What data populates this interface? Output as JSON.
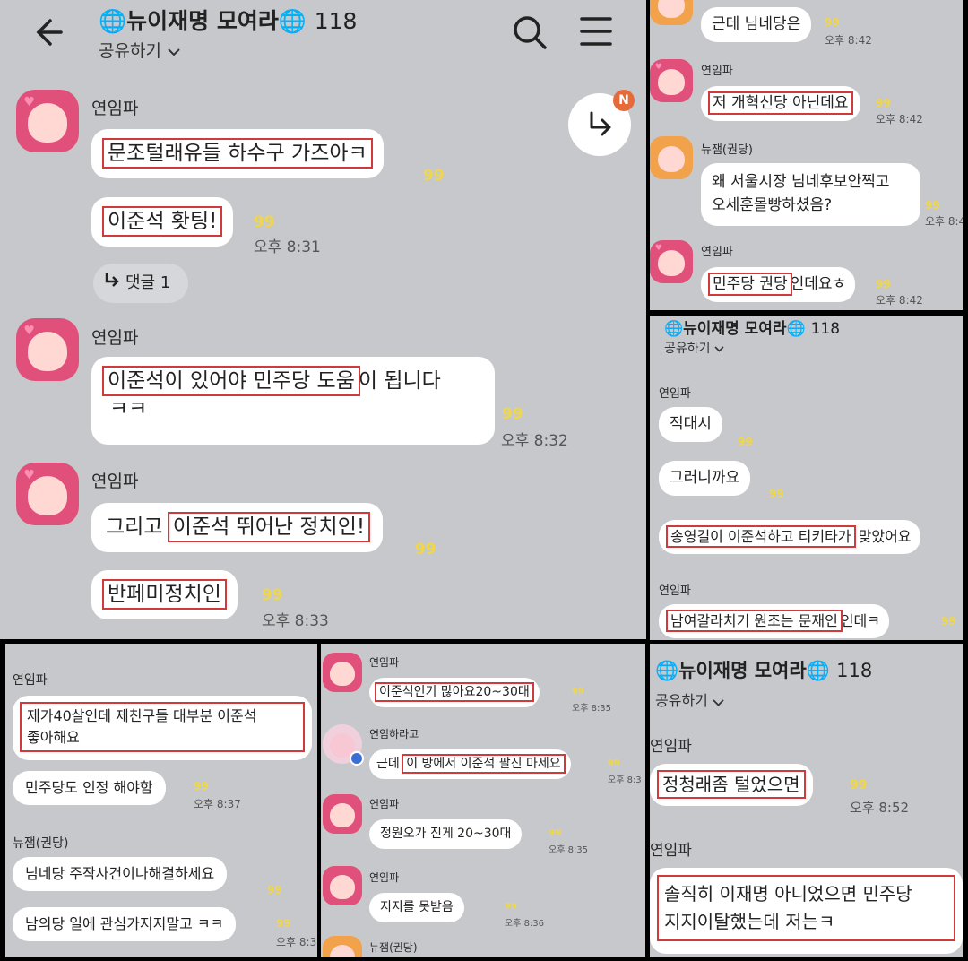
{
  "header": {
    "title": "🌐뉴이재명 모여라🌐",
    "count": "118",
    "share_label": "공유하기",
    "chevron": "chevron-down-icon",
    "back_icon": "back-arrow-icon",
    "search_icon": "search-icon",
    "menu_icon": "hamburger-menu-icon",
    "reply_badge": "N"
  },
  "colors": {
    "background": "#c6c8cc",
    "bubble": "#ffffff",
    "highlight": "#d03a3a",
    "unread": "#f0d64a"
  },
  "unread_mark": "99",
  "main": {
    "sender": "연임파",
    "messages": [
      {
        "text": "문조털래유들 하수구 가즈아ㅋ"
      },
      {
        "text": "이준석 홧팅!",
        "time": "오후 8:31"
      },
      {
        "text_a": "이준석이 있어야 민주당 도움",
        "text_b": "이 됩니다",
        "text_c": "ㅋㅋ",
        "time": "오후 8:32"
      },
      {
        "text_a": "그리고 ",
        "text_b": "이준석 뛰어난 정치인!"
      },
      {
        "text": "반페미정치인",
        "time": "오후 8:33"
      }
    ],
    "reply_label": "댓글 1"
  },
  "top_right": {
    "messages": [
      {
        "text": "근데 님네당은",
        "time": "오후 8:42"
      },
      {
        "sender": "연임파",
        "text": "저 개혁신당 아닌데요",
        "time": "오후 8:42"
      },
      {
        "sender": "뉴잼(권당)",
        "text_a": "왜 서울시장 님네후보안찍고",
        "text_b": "오세훈몰빵하셨음?",
        "time": "오후 8:4"
      },
      {
        "sender": "연임파",
        "text_a": "민주당 권당",
        "text_b": "인데요ㅎ",
        "time": "오후 8:42"
      }
    ]
  },
  "mid_right": {
    "title": "🌐뉴이재명 모여라🌐",
    "count": "118",
    "share_label": "공유하기",
    "sender": "연임파",
    "messages": [
      {
        "text": "적대시"
      },
      {
        "text": "그러니까요"
      },
      {
        "text_a": "송영길이 이준석하고 티키타가",
        "text_b": " 맞았어요"
      }
    ],
    "sender2": "연임파",
    "message2_a": "남여갈라치기 원조는 문재인",
    "message2_b": "인데ㅋ"
  },
  "bottom_left": {
    "sender": "연임파",
    "msg1_a": "제가40살인데 제친구들 대부분 이준석",
    "msg1_b": "좋아해요",
    "msg2": "민주당도 인정 해야함",
    "time2": "오후 8:37",
    "sender2": "뉴잼(권당)",
    "msg3": "님네당 주작사건이나해결하세요",
    "msg4": "남의당 일에 관심가지지말고 ㅋㅋ",
    "time4": "오후 8:3"
  },
  "bottom_mid": {
    "messages": [
      {
        "sender": "연임파",
        "text": "이준석인기 많아요20~30대",
        "time": "오후 8:35"
      },
      {
        "sender": "연임하라고",
        "text_a": "근데 ",
        "text_b": "이 방에서 이준석 팔진 마세요",
        "time": "오후 8:3"
      },
      {
        "sender": "연임파",
        "text": "정원오가 진게 20~30대",
        "time": "오후 8:35"
      },
      {
        "sender": "연임파",
        "text": "지지를 못받음",
        "time": "오후 8:36"
      },
      {
        "sender": "뉴잼(권당)"
      }
    ]
  },
  "bottom_right": {
    "title": "🌐뉴이재명 모여라🌐",
    "count": "118",
    "share_label": "공유하기",
    "sender": "연임파",
    "msg1": "정청래좀 털었으면",
    "time1": "오후 8:52",
    "sender2": "연임파",
    "msg2_a": "솔직히 이재명 아니었으면 민주당",
    "msg2_b": "지지이탈했는데 저는ㅋ"
  }
}
